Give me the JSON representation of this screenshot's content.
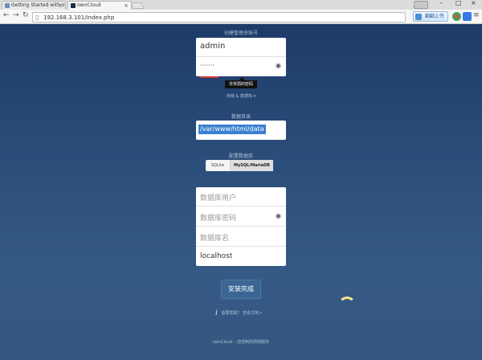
{
  "browser": {
    "tabs": [
      {
        "title": "Getting Started with o"
      },
      {
        "title": "ownCloud"
      }
    ],
    "url": "192.168.3.101/index.php",
    "extension_label": "翻翻上传",
    "window_controls": {
      "minimize": "–",
      "restore": "□",
      "close": "×"
    }
  },
  "admin": {
    "heading": "创建管理员账号",
    "username": "admin",
    "password": "·······",
    "strength_tooltip": "非常弱的密码"
  },
  "storage": {
    "toggle_label": "存储 & 数据库 ▾",
    "data_dir_label": "数据目录",
    "data_dir_value": "/var/www/html/data"
  },
  "database": {
    "label": "配置数据库",
    "options": [
      "SQLite",
      "MySQL/MariaDB"
    ],
    "selected": "MySQL/MariaDB",
    "user_placeholder": "数据库用户",
    "password_placeholder": "数据库密码",
    "name_placeholder": "数据库名",
    "host_value": "localhost"
  },
  "install_button": "安装完成",
  "help": {
    "text": "需要帮助？",
    "link": "查看文档↗"
  },
  "footer": "ownCloud – 您控制的网络服务",
  "colors": {
    "page_top": "#1d3b68",
    "page_bottom": "#33577f",
    "button": "#3b6593",
    "selection": "#3a7fd0",
    "strength_bar": "#d43838"
  }
}
